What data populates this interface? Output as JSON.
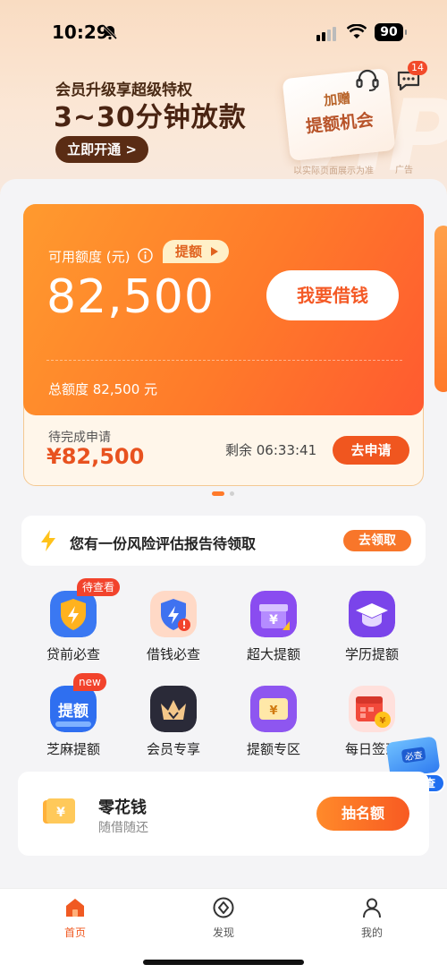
{
  "status_bar": {
    "time": "10:29",
    "battery": "90"
  },
  "banner": {
    "subtitle": "会员升级享超级特权",
    "title": "3~30分钟放款",
    "open_label": "立即开通 >",
    "message_count": "14",
    "ad_card_line1": "加赠",
    "ad_card_line2": "提额机会",
    "ad_note": "以实际页面展示为准",
    "ad_tag": "广告"
  },
  "credit": {
    "available_label": "可用额度 (元)",
    "raise_label": "提额",
    "available_amount": "82,500",
    "borrow_label": "我要借钱",
    "total_label": "总额度 82,500 元",
    "pending_label": "待完成申请",
    "pending_amount": "¥82,500",
    "countdown": "剩余 06:33:41",
    "apply_label": "去申请"
  },
  "risk_notice": {
    "text": "您有一份风险评估报告待领取",
    "action_label": "去领取"
  },
  "features": [
    {
      "label": "贷前必查",
      "icon": "shield-bolt-icon",
      "badge": "待查看"
    },
    {
      "label": "借钱必查",
      "icon": "shield-alert-icon",
      "badge": ""
    },
    {
      "label": "超大提额",
      "icon": "gift-box-icon",
      "badge": ""
    },
    {
      "label": "学历提额",
      "icon": "graduation-cap-icon",
      "badge": ""
    },
    {
      "label": "芝麻提额",
      "icon": "raise-text-icon",
      "badge": "new",
      "icon_text": "提额"
    },
    {
      "label": "会员专享",
      "icon": "crown-icon",
      "badge": ""
    },
    {
      "label": "提额专区",
      "icon": "yuan-envelope-icon",
      "badge": ""
    },
    {
      "label": "每日签到",
      "icon": "calendar-coin-icon",
      "badge": ""
    }
  ],
  "float_promo": {
    "board_text": "必查",
    "label": "贷前必查"
  },
  "product": {
    "name": "零花钱",
    "subtitle": "随借随还",
    "action_label": "抽名额"
  },
  "tabbar": [
    {
      "label": "首页",
      "icon": "home-icon",
      "active": true
    },
    {
      "label": "发现",
      "icon": "discover-icon",
      "active": false
    },
    {
      "label": "我的",
      "icon": "profile-icon",
      "active": false
    }
  ],
  "colors": {
    "accent": "#f05a22",
    "card_gradient_start": "#ff9a2e",
    "card_gradient_end": "#ff5a30",
    "banner_brown": "#5a2c14"
  }
}
